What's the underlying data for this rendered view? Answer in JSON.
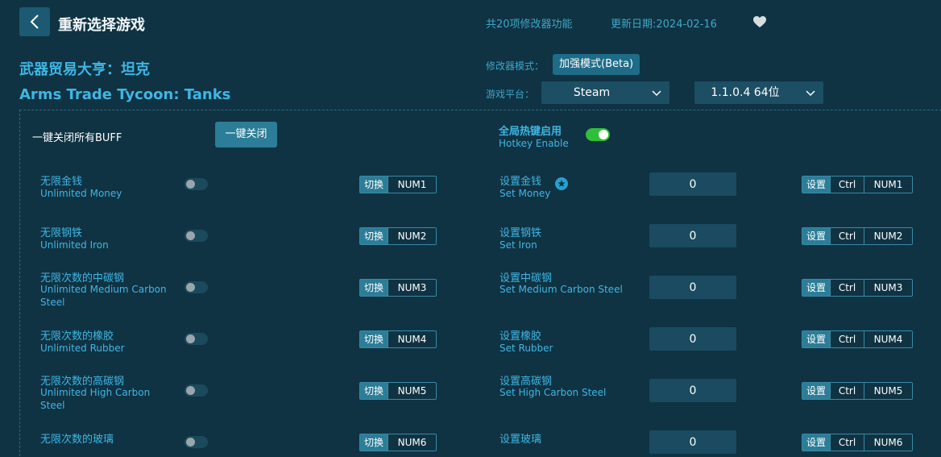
{
  "header": {
    "title": "重新选择游戏",
    "feature_count": "共20项修改器功能",
    "update_date": "更新日期:2024-02-16"
  },
  "game": {
    "name_cn": "武器贸易大亨：坦克",
    "name_en": "Arms Trade Tycoon: Tanks"
  },
  "settings": {
    "mode_label": "修改器模式：",
    "mode_value": "加强模式(Beta)",
    "platform_label": "游戏平台：",
    "platform_value": "Steam",
    "version_value": "1.1.0.4 64位"
  },
  "controls": {
    "buff_label": "一键关闭所有BUFF",
    "close_all_label": "一键关闭",
    "hotkey_cn": "全局热键启用",
    "hotkey_en": "Hotkey Enable",
    "hotkey_enabled": true
  },
  "cheats": [
    {
      "cn": "无限金钱",
      "en": "Unlimited Money",
      "action": "切换",
      "key": "NUM1",
      "enabled": false,
      "set_cn": "设置金钱",
      "set_en": "Set Money",
      "value": "0",
      "set_action": "设置",
      "mod": "Ctrl",
      "set_key": "NUM1",
      "starred": true
    },
    {
      "cn": "无限钢铁",
      "en": "Unlimited Iron",
      "action": "切换",
      "key": "NUM2",
      "enabled": false,
      "set_cn": "设置钢铁",
      "set_en": "Set Iron",
      "value": "0",
      "set_action": "设置",
      "mod": "Ctrl",
      "set_key": "NUM2",
      "starred": false
    },
    {
      "cn": "无限次数的中碳钢",
      "en": "Unlimited Medium Carbon Steel",
      "action": "切换",
      "key": "NUM3",
      "enabled": false,
      "set_cn": "设置中碳钢",
      "set_en": "Set Medium Carbon Steel",
      "value": "0",
      "set_action": "设置",
      "mod": "Ctrl",
      "set_key": "NUM3",
      "starred": false
    },
    {
      "cn": "无限次数的橡胶",
      "en": "Unlimited Rubber",
      "action": "切换",
      "key": "NUM4",
      "enabled": false,
      "set_cn": "设置橡胶",
      "set_en": "Set Rubber",
      "value": "0",
      "set_action": "设置",
      "mod": "Ctrl",
      "set_key": "NUM4",
      "starred": false
    },
    {
      "cn": "无限次数的高碳钢",
      "en": "Unlimited High Carbon Steel",
      "action": "切换",
      "key": "NUM5",
      "enabled": false,
      "set_cn": "设置高碳钢",
      "set_en": "Set High Carbon Steel",
      "value": "0",
      "set_action": "设置",
      "mod": "Ctrl",
      "set_key": "NUM5",
      "starred": false
    },
    {
      "cn": "无限次数的玻璃",
      "en": "",
      "action": "切换",
      "key": "NUM6",
      "enabled": false,
      "set_cn": "设置玻璃",
      "set_en": "",
      "value": "0",
      "set_action": "设置",
      "mod": "Ctrl",
      "set_key": "NUM6",
      "starred": false
    }
  ]
}
